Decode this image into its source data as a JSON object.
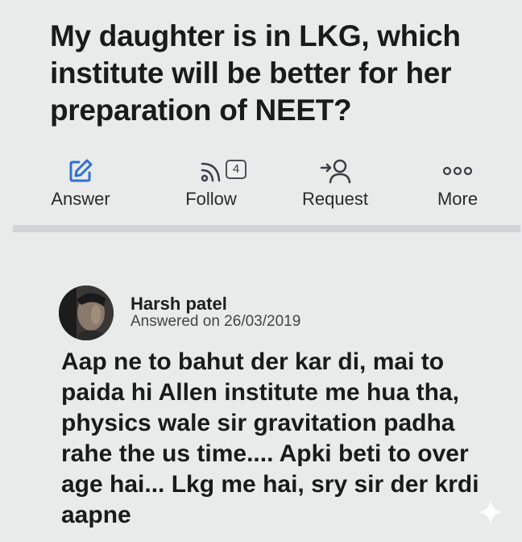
{
  "question": {
    "title": "My daughter is in LKG, which institute will be better for her preparation of NEET?"
  },
  "actions": {
    "answer_label": "Answer",
    "follow_label": "Follow",
    "follow_count": "4",
    "request_label": "Request",
    "more_label": "More"
  },
  "answer": {
    "author_name": "Harsh patel",
    "answered_date": "Answered on 26/03/2019",
    "text": "Aap ne to bahut der kar di, mai to paida hi Allen institute me hua tha, physics wale sir gravitation padha rahe the us time.... Apki beti to over age hai... Lkg me hai, sry sir der krdi aapne"
  },
  "icons": {
    "answer": "pencil-square-icon",
    "follow": "rss-feed-icon",
    "request": "person-arrow-icon",
    "more": "three-dots-icon",
    "sparkle": "sparkle-icon"
  },
  "colors": {
    "background": "#e9ebea",
    "accent_blue": "#2f6fd6",
    "divider": "#cfd3d5"
  }
}
